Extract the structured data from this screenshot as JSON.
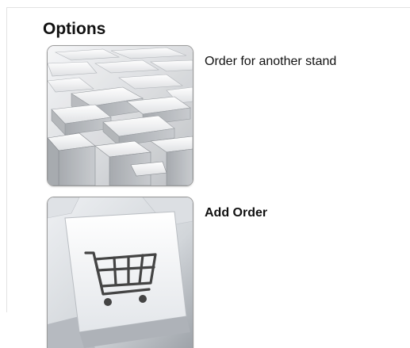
{
  "section": {
    "title": "Options"
  },
  "options": [
    {
      "label": "Order for another stand",
      "icon": "blocks-icon"
    },
    {
      "label": "Add Order",
      "icon": "shopping-cart-icon"
    }
  ],
  "colors": {
    "border": "#9a9a9a",
    "panel_border": "#e3e3e3",
    "text": "#111111"
  }
}
